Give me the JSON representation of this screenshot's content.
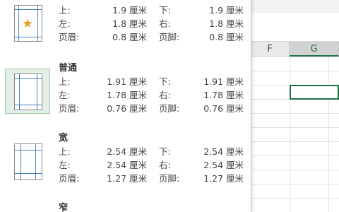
{
  "spreadsheet": {
    "columns": [
      "F",
      "G"
    ],
    "selected_column": "G"
  },
  "margins_menu": {
    "presets": [
      {
        "name": "",
        "icon": "star-icon",
        "rows": [
          {
            "l1": "上:",
            "v1": "1.9 厘米",
            "l2": "下:",
            "v2": "1.9 厘米"
          },
          {
            "l1": "左:",
            "v1": "1.8 厘米",
            "l2": "右:",
            "v2": "1.8 厘米"
          },
          {
            "l1": "页眉:",
            "v1": "0.8 厘米",
            "l2": "页脚:",
            "v2": "0.8 厘米"
          }
        ]
      },
      {
        "name": "普通",
        "selected": true,
        "rows": [
          {
            "l1": "上:",
            "v1": "1.91 厘米",
            "l2": "下:",
            "v2": "1.91 厘米"
          },
          {
            "l1": "左:",
            "v1": "1.78 厘米",
            "l2": "右:",
            "v2": "1.78 厘米"
          },
          {
            "l1": "页眉:",
            "v1": "0.76 厘米",
            "l2": "页脚:",
            "v2": "0.76 厘米"
          }
        ]
      },
      {
        "name": "宽",
        "rows": [
          {
            "l1": "上:",
            "v1": "2.54 厘米",
            "l2": "下:",
            "v2": "2.54 厘米"
          },
          {
            "l1": "左:",
            "v1": "2.54 厘米",
            "l2": "右:",
            "v2": "2.54 厘米"
          },
          {
            "l1": "页眉:",
            "v1": "1.27 厘米",
            "l2": "页脚:",
            "v2": "1.27 厘米"
          }
        ]
      },
      {
        "name": "窄",
        "rows": []
      }
    ]
  }
}
